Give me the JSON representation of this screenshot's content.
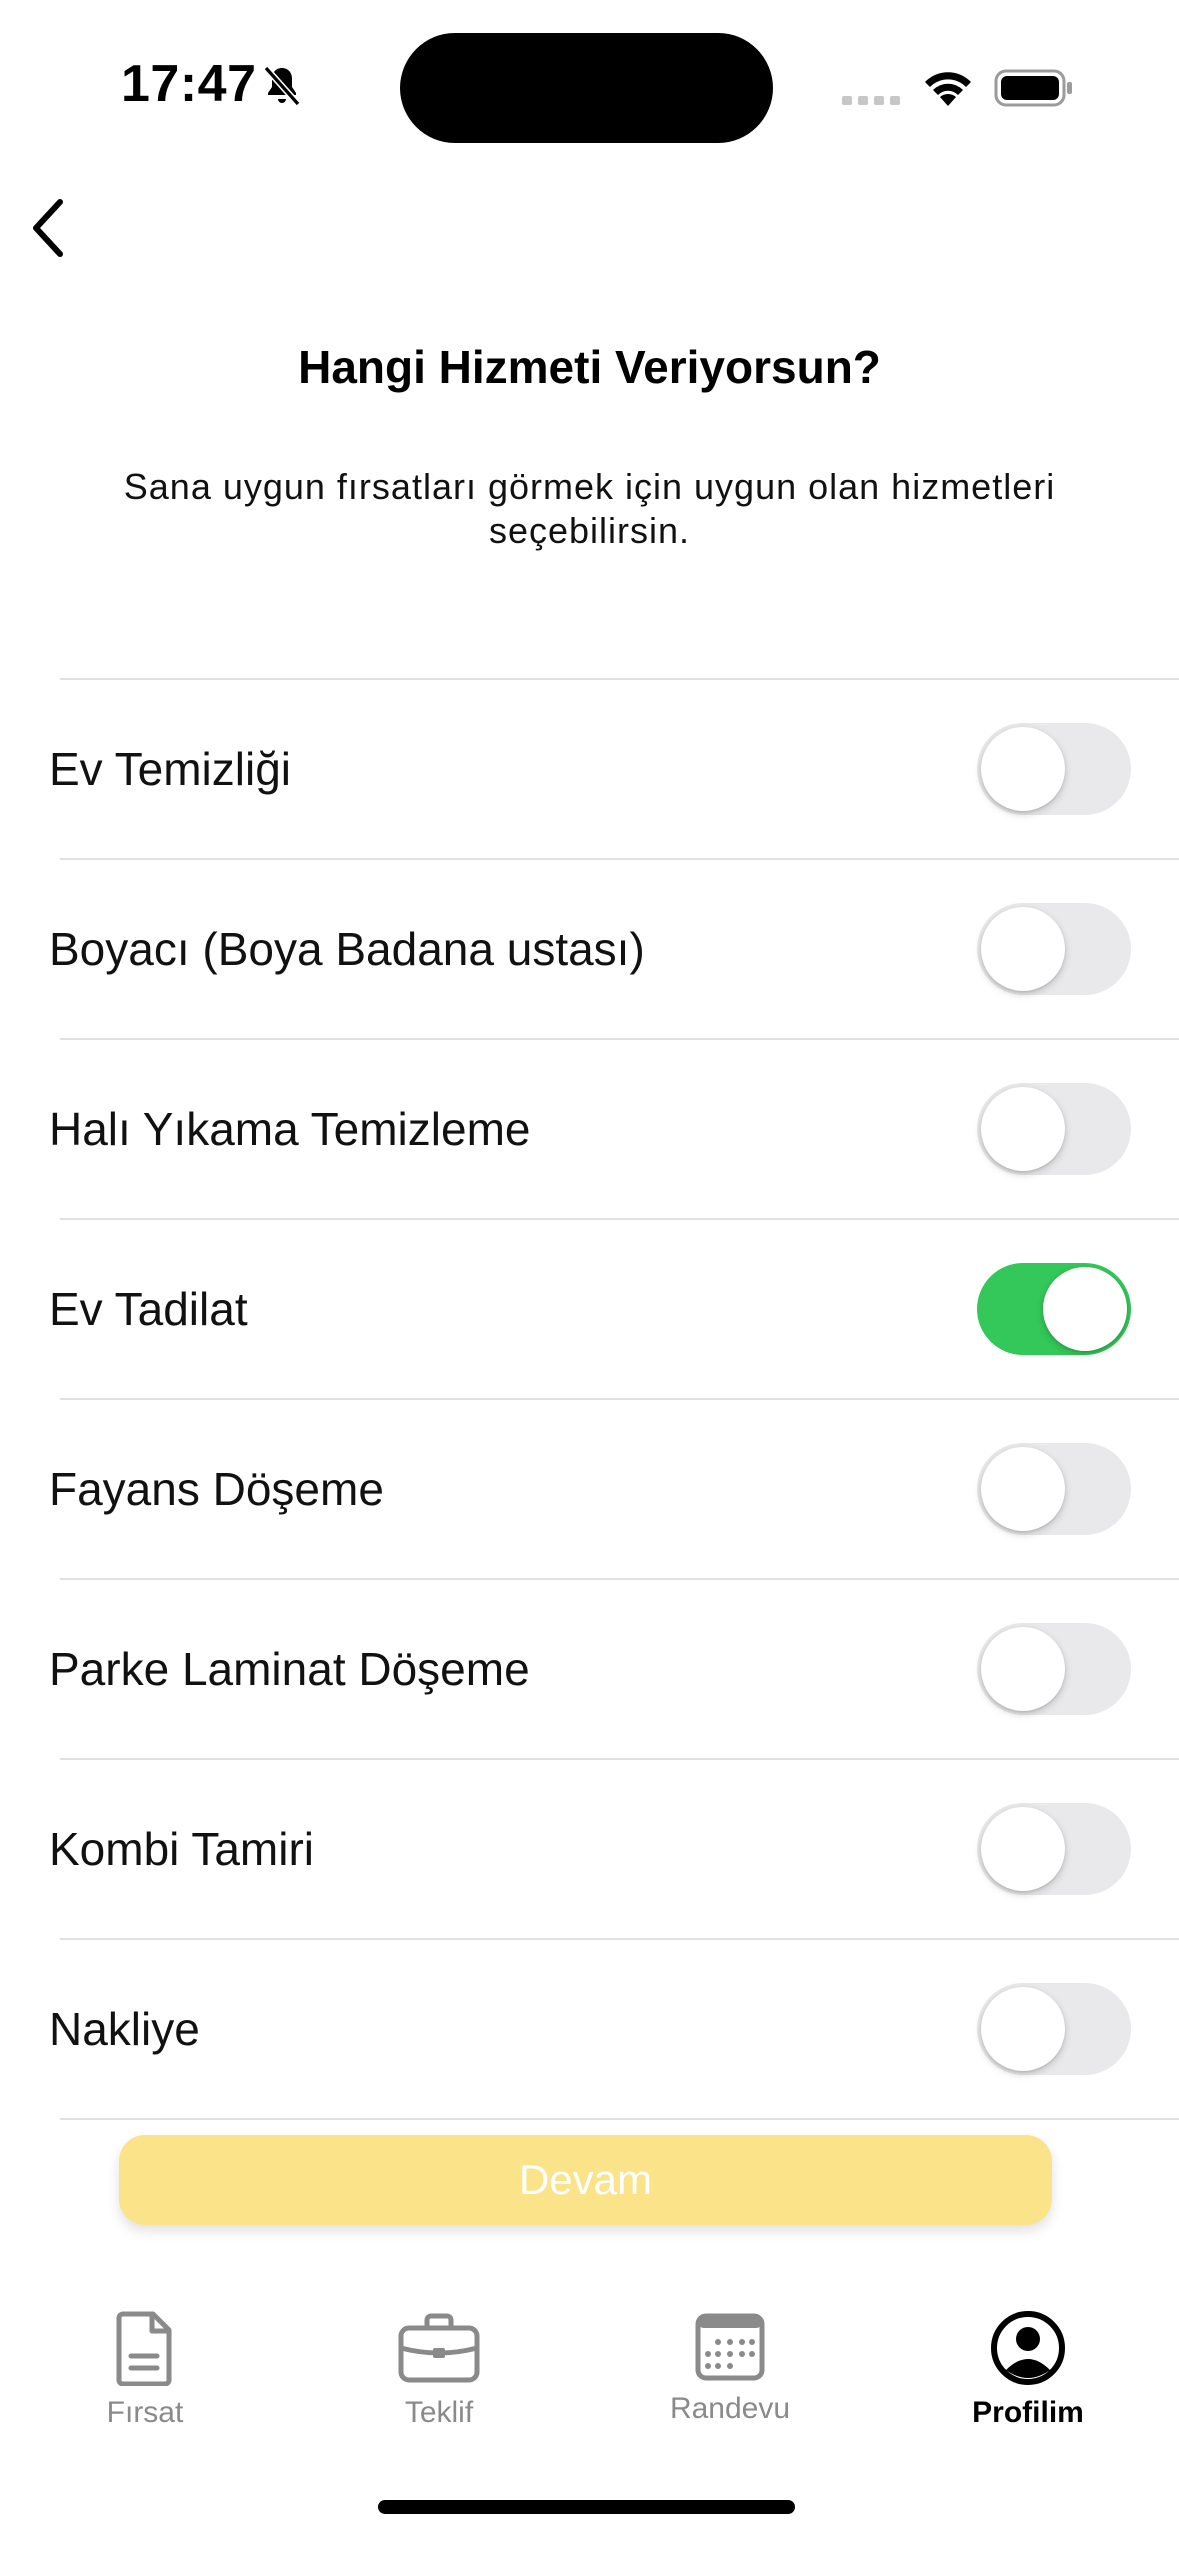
{
  "status_bar": {
    "time": "17:47",
    "icons": [
      "bell-slash-icon",
      "cellular-signal-icon",
      "wifi-icon",
      "battery-icon"
    ]
  },
  "header": {
    "back_icon": "chevron-left-icon",
    "title": "Hangi Hizmeti Veriyorsun?",
    "subtitle": "Sana uygun fırsatları görmek için uygun olan hizmetleri seçebilirsin."
  },
  "services": [
    {
      "label": "Ev Temizliği",
      "enabled": false
    },
    {
      "label": "Boyacı (Boya Badana ustası)",
      "enabled": false
    },
    {
      "label": "Halı Yıkama Temizleme",
      "enabled": false
    },
    {
      "label": "Ev Tadilat",
      "enabled": true
    },
    {
      "label": "Fayans Döşeme",
      "enabled": false
    },
    {
      "label": "Parke Laminat Döşeme",
      "enabled": false
    },
    {
      "label": "Kombi Tamiri",
      "enabled": false
    },
    {
      "label": "Nakliye",
      "enabled": false
    }
  ],
  "continue_button": {
    "label": "Devam"
  },
  "tab_bar": {
    "tabs": [
      {
        "label": "Fırsat",
        "icon": "document-icon",
        "active": false
      },
      {
        "label": "Teklif",
        "icon": "briefcase-icon",
        "active": false
      },
      {
        "label": "Randevu",
        "icon": "calendar-icon",
        "active": false
      },
      {
        "label": "Profilim",
        "icon": "profile-icon",
        "active": true
      }
    ]
  },
  "colors": {
    "toggle_on": "#34c759",
    "toggle_off": "#e9e9eb",
    "button_disabled": "#fae389",
    "tab_inactive": "#8a8a8a"
  }
}
